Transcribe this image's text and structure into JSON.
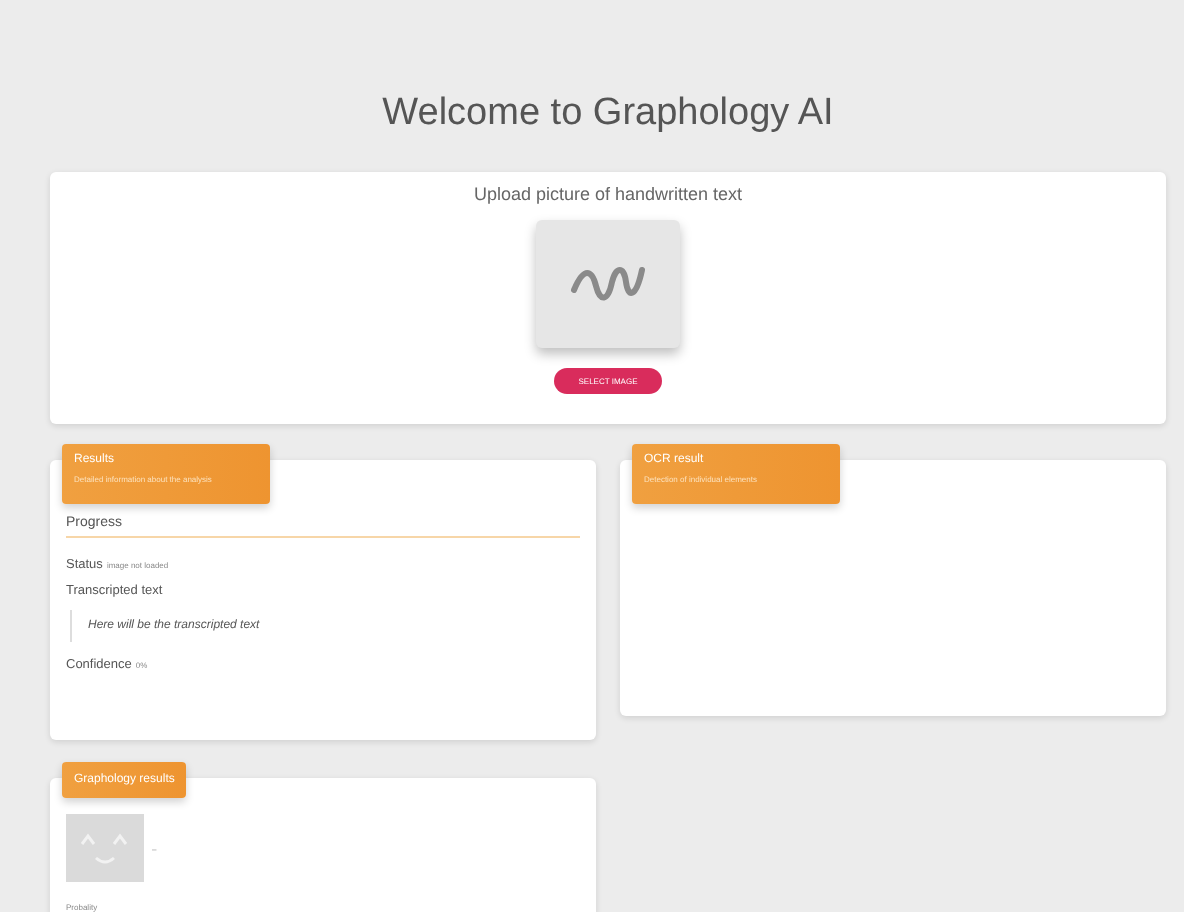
{
  "title": "Welcome to Graphology AI",
  "upload": {
    "label": "Upload picture of handwritten text",
    "button": "SELECT IMAGE"
  },
  "results": {
    "title": "Results",
    "subtitle": "Detailed information about the analysis",
    "progress_label": "Progress",
    "status_label": "Status",
    "status_value": "image not loaded",
    "transcript_label": "Transcripted text",
    "transcript": "Here will be the transcripted text",
    "confidence_label": "Confidence",
    "confidence_value": "0%"
  },
  "ocr": {
    "title": "OCR result",
    "subtitle": "Detection of individual elements"
  },
  "graphology": {
    "title": "Graphology results",
    "trait": "–",
    "probability_label": "Probality"
  }
}
